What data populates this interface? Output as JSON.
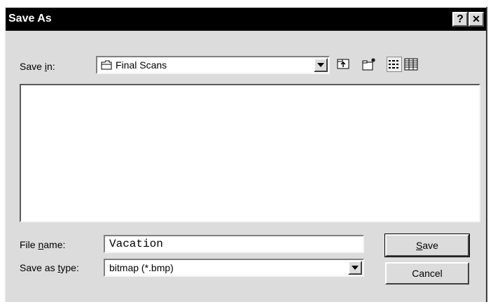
{
  "window": {
    "title": "Save As",
    "help_button": "?",
    "close_button": "✕"
  },
  "save_in": {
    "label_prefix": "Save ",
    "label_accel": "i",
    "label_suffix": "n:",
    "value": "Final Scans"
  },
  "toolbar": {
    "items": [
      "up-one-level-icon",
      "create-new-folder-icon",
      "list-view-icon",
      "details-view-icon"
    ]
  },
  "file_name": {
    "label_prefix": "File ",
    "label_accel": "n",
    "label_suffix": "ame:",
    "value": "Vacation"
  },
  "save_as_type": {
    "label_prefix": "Save as ",
    "label_accel": "t",
    "label_suffix": "ype:",
    "value": "bitmap (*.bmp)"
  },
  "buttons": {
    "save_accel": "S",
    "save_suffix": "ave",
    "cancel": "Cancel"
  },
  "colors": {
    "titlebar": "#000000",
    "face": "#dcdcdc"
  }
}
